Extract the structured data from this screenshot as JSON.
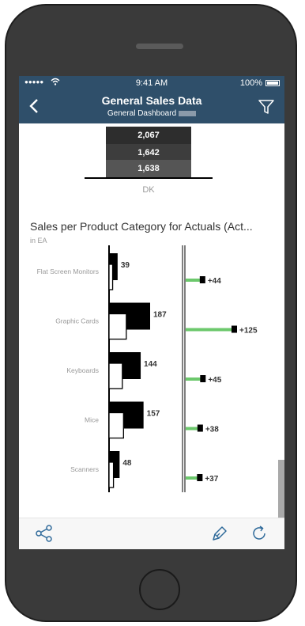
{
  "status_bar": {
    "signal": "●●●●●",
    "time": "9:41 AM",
    "battery": "100%"
  },
  "nav": {
    "title": "General Sales Data",
    "subtitle": "General Dashboard"
  },
  "top_chart": {
    "bars": [
      {
        "value": "2,067",
        "color": "#2d2d2d"
      },
      {
        "value": "1,642",
        "color": "#3d3d3d"
      },
      {
        "value": "1,638",
        "color": "#555555"
      }
    ],
    "category": "DK"
  },
  "section": {
    "title": "Sales per Product Category for Actuals (Act...",
    "subtitle": "in EA"
  },
  "chart_data": {
    "type": "bar",
    "categories": [
      "Flat Screen Monitors",
      "Graphic Cards",
      "Keyboards",
      "Mice",
      "Scanners"
    ],
    "values": [
      39,
      187,
      144,
      157,
      48
    ],
    "value_labels": [
      "39",
      "187",
      "144",
      "157",
      "48"
    ],
    "deltas": [
      44,
      125,
      45,
      38,
      37
    ],
    "delta_labels": [
      "+44",
      "+125",
      "+45",
      "+38",
      "+37"
    ],
    "delta_color": "#6cc86c"
  },
  "icons": {
    "back": "chevron-left-icon",
    "filter": "filter-icon",
    "share": "share-icon",
    "annotate": "pen-icon",
    "refresh": "refresh-icon"
  }
}
